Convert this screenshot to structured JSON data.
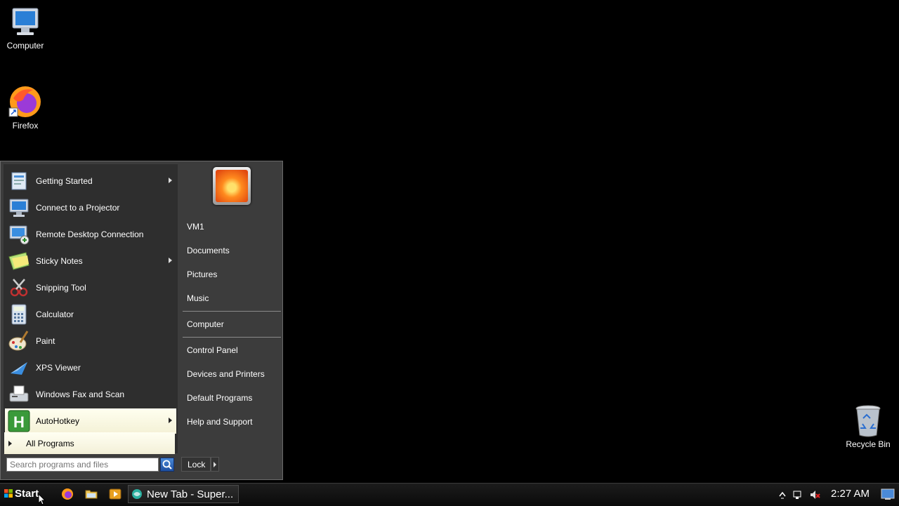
{
  "desktop": {
    "icons": [
      {
        "label": "Computer",
        "icon": "computer-icon"
      },
      {
        "label": "Firefox",
        "icon": "firefox-icon"
      },
      {
        "label": "Recycle Bin",
        "icon": "recycle-bin-icon"
      }
    ]
  },
  "start_menu": {
    "programs": [
      {
        "label": "Getting Started",
        "icon": "getting-started-icon",
        "has_submenu": true
      },
      {
        "label": "Connect to a Projector",
        "icon": "projector-icon",
        "has_submenu": false
      },
      {
        "label": "Remote Desktop Connection",
        "icon": "remote-desktop-icon",
        "has_submenu": false
      },
      {
        "label": "Sticky Notes",
        "icon": "sticky-notes-icon",
        "has_submenu": true
      },
      {
        "label": "Snipping Tool",
        "icon": "snipping-tool-icon",
        "has_submenu": false
      },
      {
        "label": "Calculator",
        "icon": "calculator-icon",
        "has_submenu": false
      },
      {
        "label": "Paint",
        "icon": "paint-icon",
        "has_submenu": false
      },
      {
        "label": "XPS Viewer",
        "icon": "xps-viewer-icon",
        "has_submenu": false
      },
      {
        "label": "Windows Fax and Scan",
        "icon": "fax-scan-icon",
        "has_submenu": false
      },
      {
        "label": "AutoHotkey",
        "icon": "autohotkey-icon",
        "has_submenu": true,
        "highlighted": true
      }
    ],
    "all_programs_label": "All Programs",
    "search_placeholder": "Search programs and files",
    "right_links": {
      "user": "VM1",
      "documents": "Documents",
      "pictures": "Pictures",
      "music": "Music",
      "computer": "Computer",
      "control_panel": "Control Panel",
      "devices_printers": "Devices and Printers",
      "default_programs": "Default Programs",
      "help_support": "Help and Support"
    },
    "lock_label": "Lock"
  },
  "taskbar": {
    "start_label": "Start",
    "quick_launch": [
      "firefox-icon",
      "explorer-folder-icon",
      "media-player-icon"
    ],
    "open_window": {
      "label": "New Tab - Super...",
      "icon": "browser-icon"
    },
    "tray_icons": [
      "show-hidden-icons-icon",
      "network-icon",
      "volume-muted-icon"
    ],
    "clock": "2:27 AM"
  },
  "colors": {
    "desktop_bg": "#000000",
    "menu_bg": "#3c3c3c",
    "highlight": "#f4f1d6"
  }
}
